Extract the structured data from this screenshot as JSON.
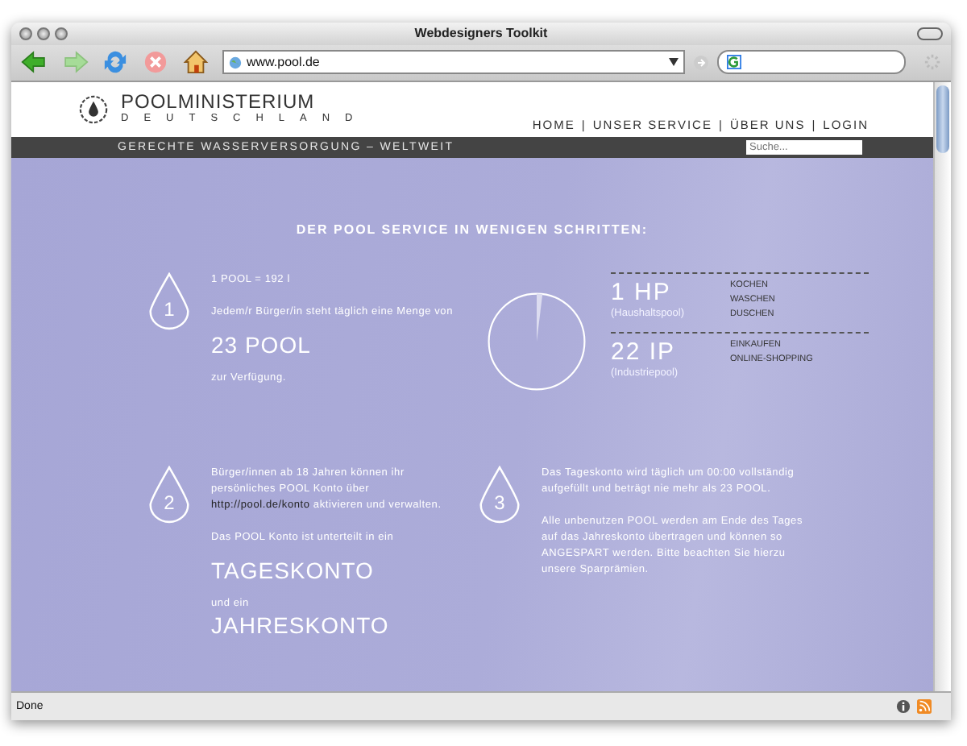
{
  "window": {
    "title": "Webdesigners Toolkit"
  },
  "toolbar": {
    "address": "www.pool.de"
  },
  "site": {
    "logo": {
      "name": "POOLMINISTERIUM",
      "subtitle": "DEUTSCHLAND"
    },
    "nav": [
      "HOME",
      "UNSER SERVICE",
      "ÜBER UNS",
      "LOGIN"
    ],
    "nav_separator": "|",
    "tagline": "GERECHTE WASSERVERSORGUNG – WELTWEIT",
    "search": {
      "placeholder": "Suche..."
    },
    "heading": "DER POOL SERVICE IN WENIGEN SCHRITTEN:",
    "steps": [
      {
        "number": "1",
        "blocks": [
          {
            "kind": "text",
            "text": "1 POOL = 192 l"
          },
          {
            "kind": "text",
            "text": "Jedem/r Bürger/in steht täglich eine Menge von"
          },
          {
            "kind": "big",
            "text": "23 POOL"
          },
          {
            "kind": "text",
            "text": "zur Verfügung."
          }
        ]
      },
      {
        "number": "2",
        "blocks": [
          {
            "kind": "link",
            "before": "Bürger/innen ab 18 Jahren können ihr persönliches POOL Konto über",
            "link": "http://pool.de/konto",
            "after": "aktivieren und verwalten."
          },
          {
            "kind": "text",
            "text": "Das POOL Konto ist unterteilt in ein"
          },
          {
            "kind": "big",
            "text": "TAGESKONTO"
          },
          {
            "kind": "small",
            "text": "und ein"
          },
          {
            "kind": "big",
            "text": "JAHRESKONTO"
          }
        ]
      },
      {
        "number": "3",
        "blocks": [
          {
            "kind": "text",
            "text": "Das Tageskonto wird täglich um 00:00 vollständig aufgefüllt und beträgt nie mehr als 23 POOL."
          },
          {
            "kind": "text",
            "text": "Alle unbenutzen POOL werden am Ende des Tages auf das Jahreskonto übertragen und können so ANGESPART werden. Bitte beachten Sie hierzu unsere Sparprämien."
          }
        ]
      }
    ],
    "pools": [
      {
        "value": "1 HP",
        "label": "(Haushaltspool)",
        "uses": [
          "KOCHEN",
          "WASCHEN",
          "DUSCHEN"
        ]
      },
      {
        "value": "22 IP",
        "label": "(Industriepool)",
        "uses": [
          "EINKAUFEN",
          "ONLINE-SHOPPING"
        ]
      }
    ]
  },
  "status_bar": {
    "text": "Done"
  }
}
